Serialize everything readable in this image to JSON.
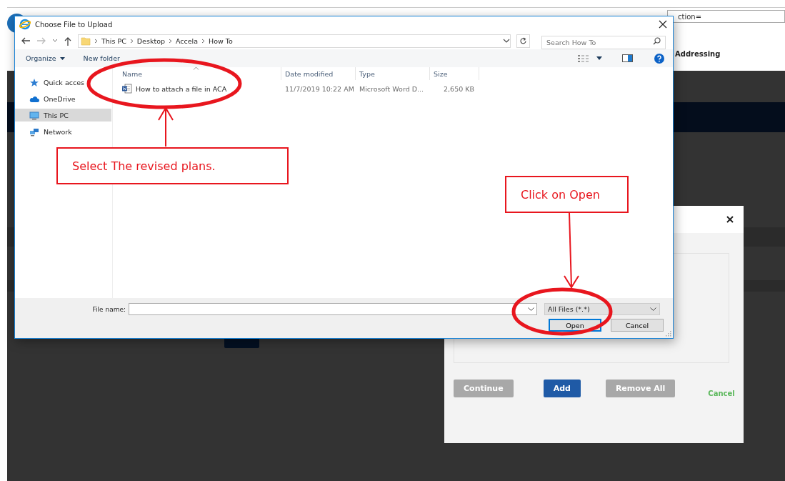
{
  "browser": {
    "address_text": "ction=",
    "toolbar_link": "Addressing"
  },
  "upload_modal": {
    "buttons": [
      {
        "label": "Continue",
        "kind": "button",
        "disabled": true
      },
      {
        "label": "Add",
        "kind": "button",
        "disabled": false
      },
      {
        "label": "Remove All",
        "kind": "button",
        "disabled": true
      },
      {
        "label": "Cancel",
        "kind": "link",
        "disabled": false
      }
    ]
  },
  "file_dialog": {
    "title": "Choose File to Upload",
    "breadcrumb": [
      "This PC",
      "Desktop",
      "Accela",
      "How To"
    ],
    "search": {
      "placeholder": "Search How To"
    },
    "toolbar": [
      {
        "label": "Organize",
        "dropdown": true
      },
      {
        "label": "New folder",
        "dropdown": false
      }
    ],
    "sidebar": [
      {
        "label": "Quick acces",
        "kind": "star",
        "selected": false
      },
      {
        "label": "OneDrive",
        "kind": "cloud",
        "selected": false
      },
      {
        "label": "This PC",
        "kind": "computer",
        "selected": true
      },
      {
        "label": "Network",
        "kind": "network",
        "selected": false
      }
    ],
    "columns": [
      "Name",
      "Date modified",
      "Type",
      "Size"
    ],
    "files": [
      {
        "name": "How to attach a file in ACA",
        "date_modified": "11/7/2019 10:22 AM",
        "type": "Microsoft Word D...",
        "size": "2,650 KB"
      }
    ],
    "file_name": {
      "label": "File name:"
    },
    "file_type": "All Files (*.*)",
    "buttons": [
      {
        "label": "Open",
        "default": true
      },
      {
        "label": "Cancel",
        "default": false
      }
    ]
  },
  "annotations": [
    {
      "text": "Select The revised plans."
    },
    {
      "text": "Click on Open"
    }
  ]
}
